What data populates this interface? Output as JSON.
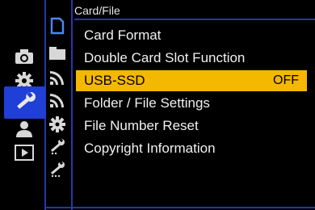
{
  "header": {
    "title": "Card/File"
  },
  "menu": {
    "items": [
      {
        "label": "Card Format",
        "value": ""
      },
      {
        "label": "Double Card Slot Function",
        "value": ""
      },
      {
        "label": "USB-SSD",
        "value": "OFF"
      },
      {
        "label": "Folder / File Settings",
        "value": ""
      },
      {
        "label": "File Number Reset",
        "value": ""
      },
      {
        "label": "Copyright Information",
        "value": ""
      }
    ],
    "selected_index": 2
  },
  "categories": [
    {
      "icon": "camera-icon"
    },
    {
      "icon": "gear-icon"
    },
    {
      "icon": "wrench-icon",
      "active": true
    },
    {
      "icon": "person-icon"
    },
    {
      "icon": "playback-icon"
    }
  ],
  "tabs": [
    {
      "icon": "card-icon",
      "active": true
    },
    {
      "icon": "folder-icon"
    },
    {
      "icon": "signal-icon"
    },
    {
      "icon": "signal-icon"
    },
    {
      "icon": "gear-icon"
    },
    {
      "icon": "wrench-icon"
    },
    {
      "icon": "wrench-icon"
    }
  ],
  "colors": {
    "accent_blue": "#1f3fd6",
    "highlight": "#f4b800",
    "rail": "#2438a8"
  }
}
